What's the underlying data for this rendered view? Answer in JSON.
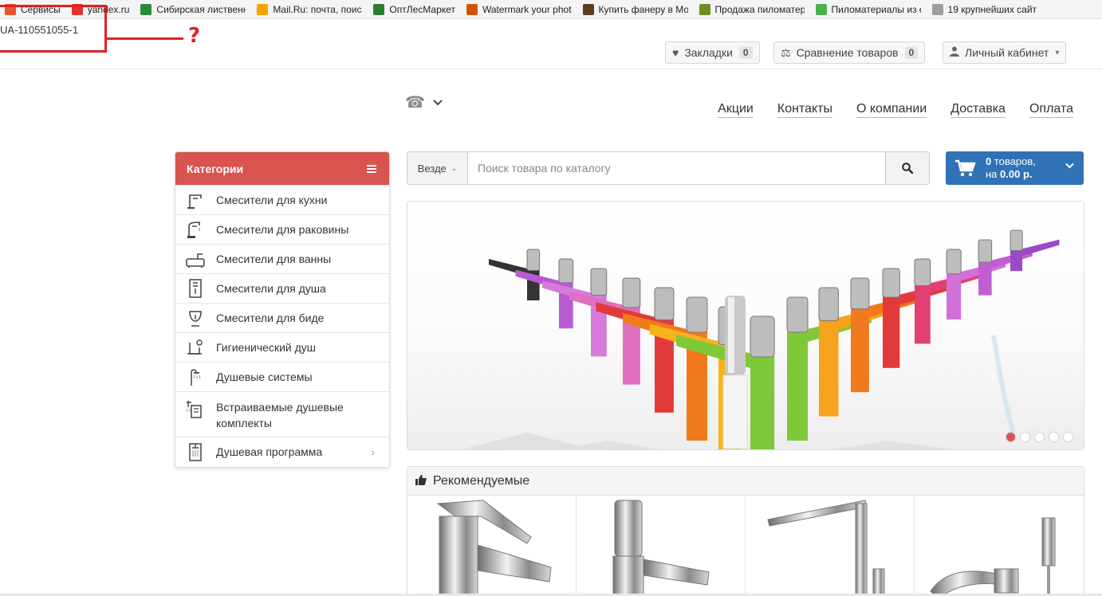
{
  "bookmarks": [
    {
      "label": "Сервисы",
      "color": "#e8542c"
    },
    {
      "label": "yandex.ru",
      "color": "#e8302c"
    },
    {
      "label": "Сибирская лиственн",
      "color": "#2a8a3a"
    },
    {
      "label": "Mail.Ru: почта, поиск",
      "color": "#f7a400"
    },
    {
      "label": "ОптЛесМаркет",
      "color": "#2e7d32"
    },
    {
      "label": "Watermark your phot",
      "color": "#d35400"
    },
    {
      "label": "Купить фанеру в Мо",
      "color": "#5a3d1e"
    },
    {
      "label": "Продажа пиломатер",
      "color": "#6b8e23"
    },
    {
      "label": "Пиломатериалы из с",
      "color": "#4caf50"
    },
    {
      "label": "19 крупнейших сайт",
      "color": "#9e9e9e"
    }
  ],
  "annotation": {
    "id_text": "UA-110551055-1",
    "mark": "?"
  },
  "top_links": {
    "bookmarks": {
      "label": "Закладки",
      "count": "0"
    },
    "compare": {
      "label": "Сравнение товаров",
      "count": "0"
    },
    "account": {
      "label": "Личный кабинет"
    }
  },
  "nav": [
    "Акции",
    "Контакты",
    "О компании",
    "Доставка",
    "Оплата"
  ],
  "categories": {
    "title": "Категории",
    "items": [
      {
        "label": "Смесители для кухни",
        "icon": "kitchen-faucet-icon"
      },
      {
        "label": "Смесители для раковины",
        "icon": "sink-faucet-icon"
      },
      {
        "label": "Смесители для ванны",
        "icon": "bath-faucet-icon"
      },
      {
        "label": "Смесители для душа",
        "icon": "shower-faucet-icon"
      },
      {
        "label": "Смесители для биде",
        "icon": "bidet-icon"
      },
      {
        "label": "Гигиенический душ",
        "icon": "hygienic-shower-icon"
      },
      {
        "label": "Душевые системы",
        "icon": "shower-system-icon"
      },
      {
        "label": "Встраиваемые душевые комплекты",
        "icon": "built-in-shower-icon"
      },
      {
        "label": "Душевая программа",
        "icon": "shower-program-icon"
      }
    ]
  },
  "search": {
    "scope": "Везде",
    "placeholder": "Поиск товара по каталогу"
  },
  "cart": {
    "count_bold": "0",
    "count_text": " товаров,",
    "sum_prefix": "на ",
    "sum": "0.00 р."
  },
  "recommended": {
    "title": "Рекомендуемые"
  },
  "colors": {
    "accent_red": "#d9534f",
    "cart_blue": "#3072b6",
    "annotation_red": "#e02020"
  }
}
